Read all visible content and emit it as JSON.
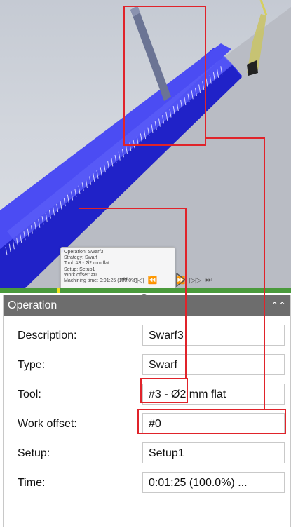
{
  "tooltip": {
    "lines": [
      "Operation: Swarf3",
      "Strategy: Swarf",
      "Tool: #3 - Ø2 mm flat",
      "Setup: Setup1",
      "Work offset: #0",
      "Machining time: 0:01:25 (100.0%)"
    ]
  },
  "player": {
    "icons": [
      "skip-start-icon",
      "step-back-icon",
      "rewind-icon",
      "play-icon",
      "fast-forward-icon",
      "step-forward-icon",
      "skip-end-icon"
    ]
  },
  "panel": {
    "title": "Operation",
    "rows": [
      {
        "label": "Description:",
        "value": "Swarf3"
      },
      {
        "label": "Type:",
        "value": "Swarf"
      },
      {
        "label": "Tool:",
        "value": "#3 - Ø2 mm flat"
      },
      {
        "label": "Work offset:",
        "value": "#0"
      },
      {
        "label": "Setup:",
        "value": "Setup1"
      },
      {
        "label": "Time:",
        "value": "0:01:25 (100.0%) ..."
      }
    ]
  },
  "colors": {
    "highlight": "#e0232a",
    "part": "#3a3af0",
    "timeline": "#4a9a3c",
    "panel_header": "#6d6d6d"
  }
}
